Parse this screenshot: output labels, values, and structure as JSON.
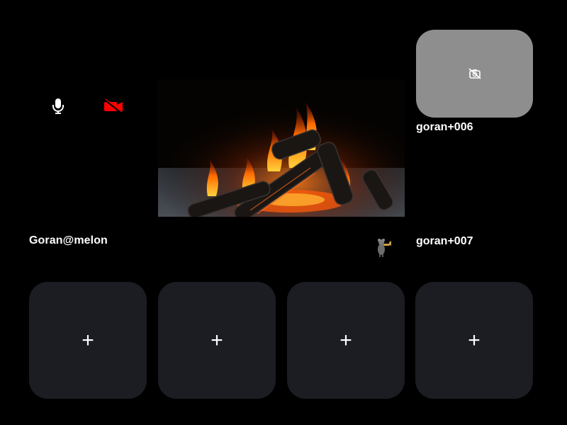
{
  "self": {
    "name": "Goran@melon",
    "mic_icon": "microphone-icon",
    "camera_icon": "video-off-icon",
    "camera_state_color": "#ff0000"
  },
  "remotes": [
    {
      "name": "goran+006",
      "camera_icon": "camera-off-icon",
      "tile_color": "#8e8e8e"
    },
    {
      "name": "goran+007"
    }
  ],
  "slots": [
    {
      "label": "+"
    },
    {
      "label": "+"
    },
    {
      "label": "+"
    },
    {
      "label": "+"
    }
  ],
  "colors": {
    "background": "#000000",
    "slot": "#1b1d22",
    "text": "#ffffff"
  }
}
